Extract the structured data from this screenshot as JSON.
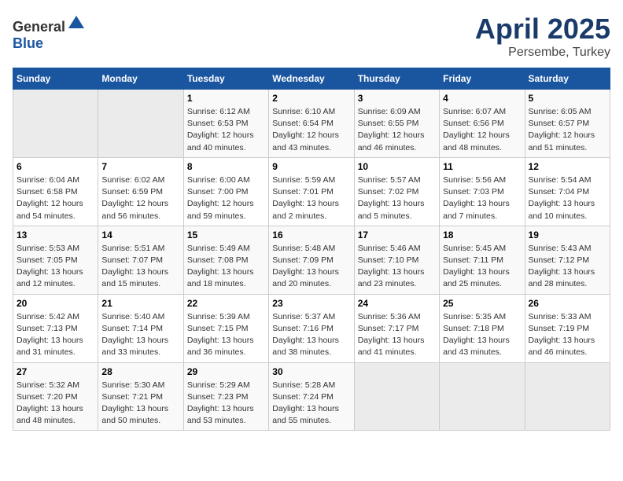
{
  "header": {
    "logo_general": "General",
    "logo_blue": "Blue",
    "month": "April 2025",
    "location": "Persembe, Turkey"
  },
  "weekdays": [
    "Sunday",
    "Monday",
    "Tuesday",
    "Wednesday",
    "Thursday",
    "Friday",
    "Saturday"
  ],
  "weeks": [
    [
      {
        "day": "",
        "sunrise": "",
        "sunset": "",
        "daylight": ""
      },
      {
        "day": "",
        "sunrise": "",
        "sunset": "",
        "daylight": ""
      },
      {
        "day": "1",
        "sunrise": "Sunrise: 6:12 AM",
        "sunset": "Sunset: 6:53 PM",
        "daylight": "Daylight: 12 hours and 40 minutes."
      },
      {
        "day": "2",
        "sunrise": "Sunrise: 6:10 AM",
        "sunset": "Sunset: 6:54 PM",
        "daylight": "Daylight: 12 hours and 43 minutes."
      },
      {
        "day": "3",
        "sunrise": "Sunrise: 6:09 AM",
        "sunset": "Sunset: 6:55 PM",
        "daylight": "Daylight: 12 hours and 46 minutes."
      },
      {
        "day": "4",
        "sunrise": "Sunrise: 6:07 AM",
        "sunset": "Sunset: 6:56 PM",
        "daylight": "Daylight: 12 hours and 48 minutes."
      },
      {
        "day": "5",
        "sunrise": "Sunrise: 6:05 AM",
        "sunset": "Sunset: 6:57 PM",
        "daylight": "Daylight: 12 hours and 51 minutes."
      }
    ],
    [
      {
        "day": "6",
        "sunrise": "Sunrise: 6:04 AM",
        "sunset": "Sunset: 6:58 PM",
        "daylight": "Daylight: 12 hours and 54 minutes."
      },
      {
        "day": "7",
        "sunrise": "Sunrise: 6:02 AM",
        "sunset": "Sunset: 6:59 PM",
        "daylight": "Daylight: 12 hours and 56 minutes."
      },
      {
        "day": "8",
        "sunrise": "Sunrise: 6:00 AM",
        "sunset": "Sunset: 7:00 PM",
        "daylight": "Daylight: 12 hours and 59 minutes."
      },
      {
        "day": "9",
        "sunrise": "Sunrise: 5:59 AM",
        "sunset": "Sunset: 7:01 PM",
        "daylight": "Daylight: 13 hours and 2 minutes."
      },
      {
        "day": "10",
        "sunrise": "Sunrise: 5:57 AM",
        "sunset": "Sunset: 7:02 PM",
        "daylight": "Daylight: 13 hours and 5 minutes."
      },
      {
        "day": "11",
        "sunrise": "Sunrise: 5:56 AM",
        "sunset": "Sunset: 7:03 PM",
        "daylight": "Daylight: 13 hours and 7 minutes."
      },
      {
        "day": "12",
        "sunrise": "Sunrise: 5:54 AM",
        "sunset": "Sunset: 7:04 PM",
        "daylight": "Daylight: 13 hours and 10 minutes."
      }
    ],
    [
      {
        "day": "13",
        "sunrise": "Sunrise: 5:53 AM",
        "sunset": "Sunset: 7:05 PM",
        "daylight": "Daylight: 13 hours and 12 minutes."
      },
      {
        "day": "14",
        "sunrise": "Sunrise: 5:51 AM",
        "sunset": "Sunset: 7:07 PM",
        "daylight": "Daylight: 13 hours and 15 minutes."
      },
      {
        "day": "15",
        "sunrise": "Sunrise: 5:49 AM",
        "sunset": "Sunset: 7:08 PM",
        "daylight": "Daylight: 13 hours and 18 minutes."
      },
      {
        "day": "16",
        "sunrise": "Sunrise: 5:48 AM",
        "sunset": "Sunset: 7:09 PM",
        "daylight": "Daylight: 13 hours and 20 minutes."
      },
      {
        "day": "17",
        "sunrise": "Sunrise: 5:46 AM",
        "sunset": "Sunset: 7:10 PM",
        "daylight": "Daylight: 13 hours and 23 minutes."
      },
      {
        "day": "18",
        "sunrise": "Sunrise: 5:45 AM",
        "sunset": "Sunset: 7:11 PM",
        "daylight": "Daylight: 13 hours and 25 minutes."
      },
      {
        "day": "19",
        "sunrise": "Sunrise: 5:43 AM",
        "sunset": "Sunset: 7:12 PM",
        "daylight": "Daylight: 13 hours and 28 minutes."
      }
    ],
    [
      {
        "day": "20",
        "sunrise": "Sunrise: 5:42 AM",
        "sunset": "Sunset: 7:13 PM",
        "daylight": "Daylight: 13 hours and 31 minutes."
      },
      {
        "day": "21",
        "sunrise": "Sunrise: 5:40 AM",
        "sunset": "Sunset: 7:14 PM",
        "daylight": "Daylight: 13 hours and 33 minutes."
      },
      {
        "day": "22",
        "sunrise": "Sunrise: 5:39 AM",
        "sunset": "Sunset: 7:15 PM",
        "daylight": "Daylight: 13 hours and 36 minutes."
      },
      {
        "day": "23",
        "sunrise": "Sunrise: 5:37 AM",
        "sunset": "Sunset: 7:16 PM",
        "daylight": "Daylight: 13 hours and 38 minutes."
      },
      {
        "day": "24",
        "sunrise": "Sunrise: 5:36 AM",
        "sunset": "Sunset: 7:17 PM",
        "daylight": "Daylight: 13 hours and 41 minutes."
      },
      {
        "day": "25",
        "sunrise": "Sunrise: 5:35 AM",
        "sunset": "Sunset: 7:18 PM",
        "daylight": "Daylight: 13 hours and 43 minutes."
      },
      {
        "day": "26",
        "sunrise": "Sunrise: 5:33 AM",
        "sunset": "Sunset: 7:19 PM",
        "daylight": "Daylight: 13 hours and 46 minutes."
      }
    ],
    [
      {
        "day": "27",
        "sunrise": "Sunrise: 5:32 AM",
        "sunset": "Sunset: 7:20 PM",
        "daylight": "Daylight: 13 hours and 48 minutes."
      },
      {
        "day": "28",
        "sunrise": "Sunrise: 5:30 AM",
        "sunset": "Sunset: 7:21 PM",
        "daylight": "Daylight: 13 hours and 50 minutes."
      },
      {
        "day": "29",
        "sunrise": "Sunrise: 5:29 AM",
        "sunset": "Sunset: 7:23 PM",
        "daylight": "Daylight: 13 hours and 53 minutes."
      },
      {
        "day": "30",
        "sunrise": "Sunrise: 5:28 AM",
        "sunset": "Sunset: 7:24 PM",
        "daylight": "Daylight: 13 hours and 55 minutes."
      },
      {
        "day": "",
        "sunrise": "",
        "sunset": "",
        "daylight": ""
      },
      {
        "day": "",
        "sunrise": "",
        "sunset": "",
        "daylight": ""
      },
      {
        "day": "",
        "sunrise": "",
        "sunset": "",
        "daylight": ""
      }
    ]
  ]
}
